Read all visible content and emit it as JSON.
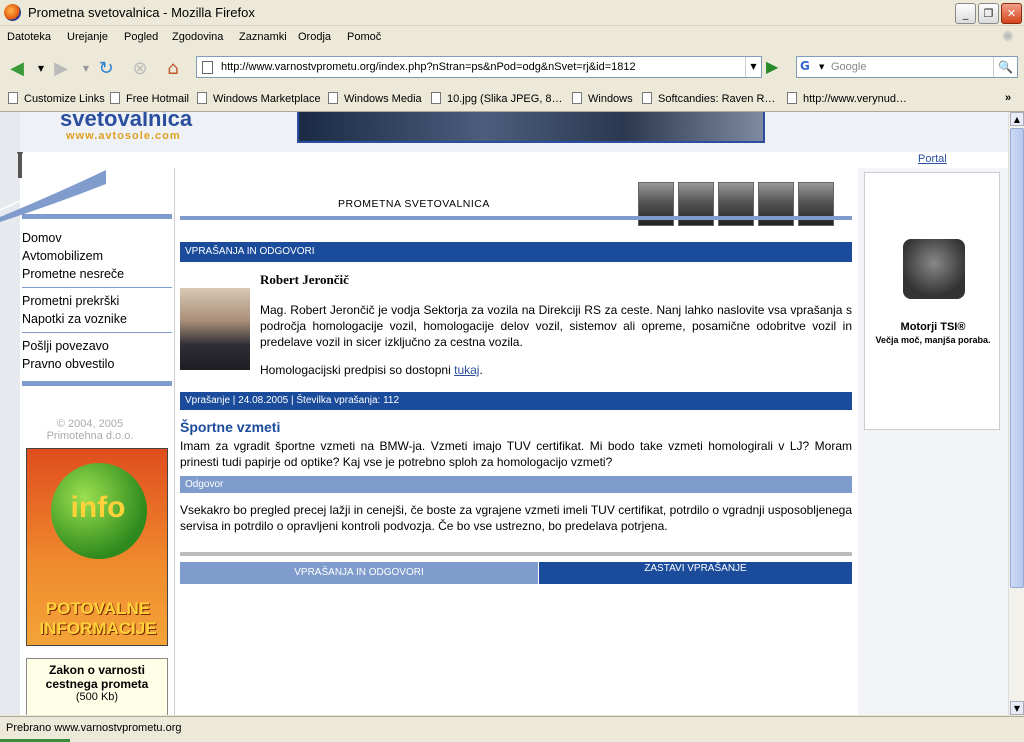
{
  "window": {
    "title": "Prometna svetovalnica - Mozilla Firefox",
    "minimize": "_",
    "restore": "❐",
    "close": "✕"
  },
  "menu": [
    "Datoteka",
    "Urejanje",
    "Pogled",
    "Zgodovina",
    "Zaznamki",
    "Orodja",
    "Pomoč"
  ],
  "toolbar": {
    "url": "http://www.varnostvprometu.org/index.php?nStran=ps&nPod=odg&nSvet=rj&id=1812",
    "search_engine": "G",
    "search_placeholder": "Google"
  },
  "bookmarks": [
    "Customize Links",
    "Free Hotmail",
    "Windows Marketplace",
    "Windows Media",
    "10.jpg (Slika JPEG, 8…",
    "Windows",
    "Softcandies: Raven R…",
    "http://www.verynud…"
  ],
  "bookmarks_more": "»",
  "site": {
    "logo": "svetovalnica",
    "logo_url": "www.avtosole.com",
    "portal_link": "Portal"
  },
  "nav": {
    "group1": [
      "Domov",
      "Avtomobilizem",
      "Prometne nesreče"
    ],
    "group2": [
      "Prometni prekrški",
      "Napotki za voznike"
    ],
    "group3": [
      "Pošlji povezavo",
      "Pravno obvestilo"
    ]
  },
  "copyright": {
    "line1": "© 2004, 2005",
    "line2": "Primotehna d.o.o."
  },
  "info_ad": {
    "word": "info",
    "line1": "POTOVALNE",
    "line2": "INFORMACIJE"
  },
  "zakon": {
    "title": "Zakon o varnosti cestnega prometa",
    "size": "(500 Kb)"
  },
  "right_ad": {
    "title": "Motorji TSI®",
    "subtitle": "Večja moč, manjša poraba."
  },
  "content": {
    "page_title": "PROMETNA SVETOVALNICA",
    "section_header": "VPRAŠANJA IN ODGOVORI",
    "person_name": "Robert Jerončič",
    "person_bio": "Mag. Robert Jerončič je vodja Sektorja za vozila na Direkciji RS za ceste. Nanj lahko naslovite vsa vprašanja s področja homologacije vozil, homologacije delov vozil, sistemov ali opreme, posamične odobritve vozil in predelave vozil in sicer izključno za cestna vozila.",
    "homolog_prefix": "Homologacijski predpisi so dostopni ",
    "homolog_link": "tukaj",
    "homolog_suffix": ".",
    "question_meta": "Vprašanje   |   24.08.2005  |  Številka vprašanja: 112",
    "question_title": "Športne vzmeti",
    "question_text": "Imam za vgradit športne vzmeti na BMW-ja. Vzmeti imajo TUV certifikat. Mi bodo take vzmeti homologirali v LJ? Moram prinesti tudi papirje od optike? Kaj vse je potrebno sploh za homologacijo vzmeti?",
    "answer_label": "Odgovor",
    "answer_text": "Vsekakro bo pregled precej lažji in cenejši, če boste za vgrajene vzmeti imeli TUV certifikat, potrdilo o vgradnji usposobljenega servisa in potrdilo o opravljeni kontroli podvozja. Če bo vse ustrezno, bo predelava potrjena.",
    "btn_qa": "VPRAŠANJA IN ODGOVORI",
    "btn_ask": "ZASTAVI VPRAŠANJE"
  },
  "status": "Prebrano www.varnostvprometu.org",
  "colors": {
    "brand_blue": "#1b4c9c",
    "light_blue": "#7f9ccd"
  }
}
